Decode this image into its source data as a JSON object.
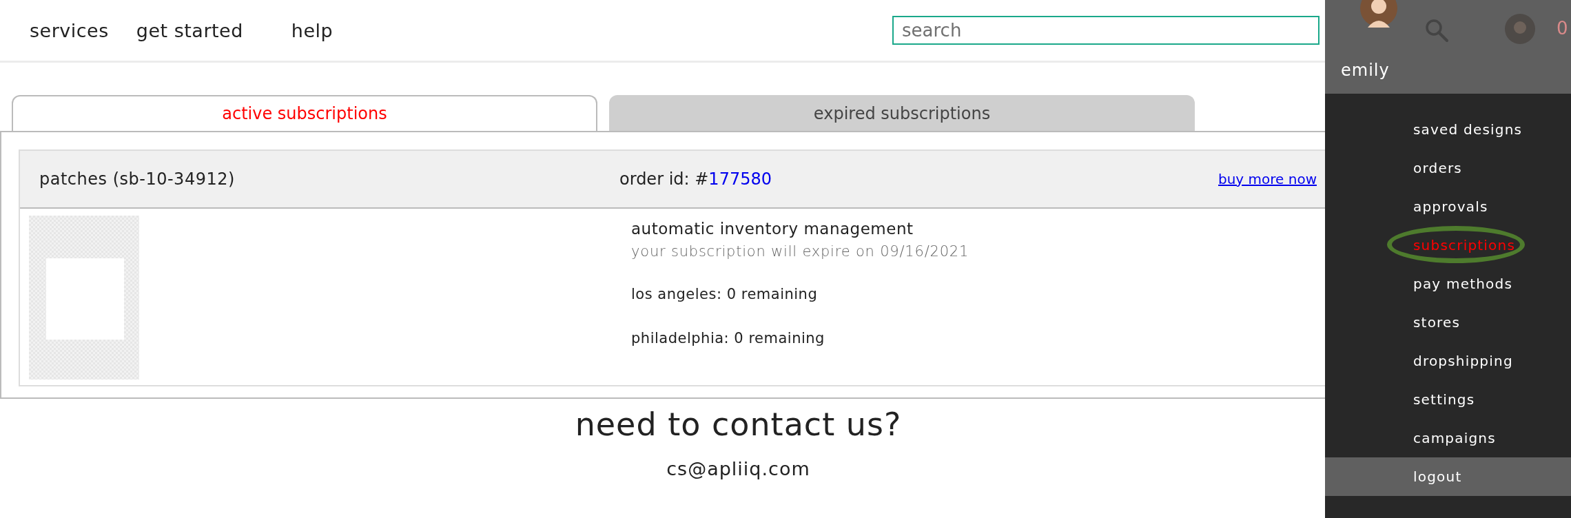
{
  "nav": {
    "links": [
      "services",
      "get started",
      "help"
    ]
  },
  "search": {
    "placeholder": "search"
  },
  "tabs": [
    {
      "label": "active subscriptions",
      "selected": true
    },
    {
      "label": "expired subscriptions",
      "selected": false
    }
  ],
  "subscriptions": [
    {
      "product": "patches (sb-10-34912)",
      "order_label": "order id: #",
      "order_id": "177580",
      "action": "buy more now",
      "title": "automatic inventory management",
      "expiry": "your subscription will expire on 09/16/2021",
      "locations": [
        "los angeles: 0 remaining",
        "philadelphia: 0 remaining"
      ]
    }
  ],
  "contact": {
    "heading": "need to contact us?",
    "email": "cs@apliiq.com"
  },
  "user_menu": {
    "name": "emily",
    "cart_count": "0",
    "items": [
      {
        "label": "saved designs",
        "selected": false,
        "circled": false,
        "kind": "link"
      },
      {
        "label": "orders",
        "selected": false,
        "circled": false,
        "kind": "link"
      },
      {
        "label": "approvals",
        "selected": false,
        "circled": false,
        "kind": "link"
      },
      {
        "label": "subscriptions",
        "selected": true,
        "circled": true,
        "kind": "link"
      },
      {
        "label": "pay methods",
        "selected": false,
        "circled": false,
        "kind": "link"
      },
      {
        "label": "stores",
        "selected": false,
        "circled": false,
        "kind": "link"
      },
      {
        "label": "dropshipping",
        "selected": false,
        "circled": false,
        "kind": "link"
      },
      {
        "label": "settings",
        "selected": false,
        "circled": false,
        "kind": "link"
      },
      {
        "label": "campaigns",
        "selected": false,
        "circled": false,
        "kind": "link"
      },
      {
        "label": "logout",
        "selected": false,
        "circled": false,
        "kind": "footer"
      }
    ]
  }
}
